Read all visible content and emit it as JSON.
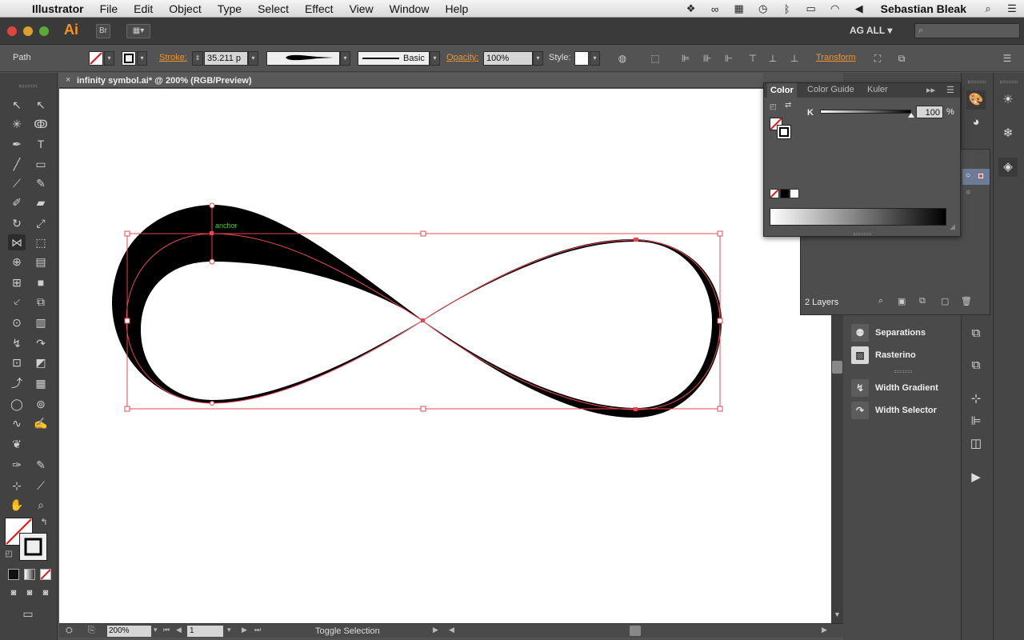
{
  "menubar": {
    "app_name": "Illustrator",
    "items": [
      "File",
      "Edit",
      "Object",
      "Type",
      "Select",
      "Effect",
      "View",
      "Window",
      "Help"
    ],
    "user": "Sebastian Bleak"
  },
  "appbar": {
    "logo": "Ai",
    "bridge": "Br",
    "workspace": "AG ALL",
    "workspace_arrow": "▾"
  },
  "control": {
    "selection_type": "Path",
    "stroke_label": "Stroke:",
    "stroke_value": "35.211 p",
    "profile_label": "Basic",
    "opacity_label": "Opacity:",
    "opacity_value": "100%",
    "style_label": "Style:",
    "transform_label": "Transform"
  },
  "document": {
    "tab_title": "infinity symbol.ai* @ 200% (RGB/Preview)",
    "close": "×",
    "anchor_label": "anchor"
  },
  "status": {
    "zoom": "200%",
    "page": "1",
    "message": "Toggle Selection"
  },
  "color_panel": {
    "tabs": [
      "Color",
      "Color Guide",
      "Kuler"
    ],
    "channel": "K",
    "value": "100",
    "unit": "%"
  },
  "layers": {
    "count": "2 Layers"
  },
  "plugins": [
    "Separations",
    "Rasterino",
    "Width Gradient",
    "Width Selector"
  ],
  "colors": {
    "accent_orange": "#f7931e",
    "selection_red": "#e8474f",
    "anchor_green": "#3fcf2f"
  }
}
